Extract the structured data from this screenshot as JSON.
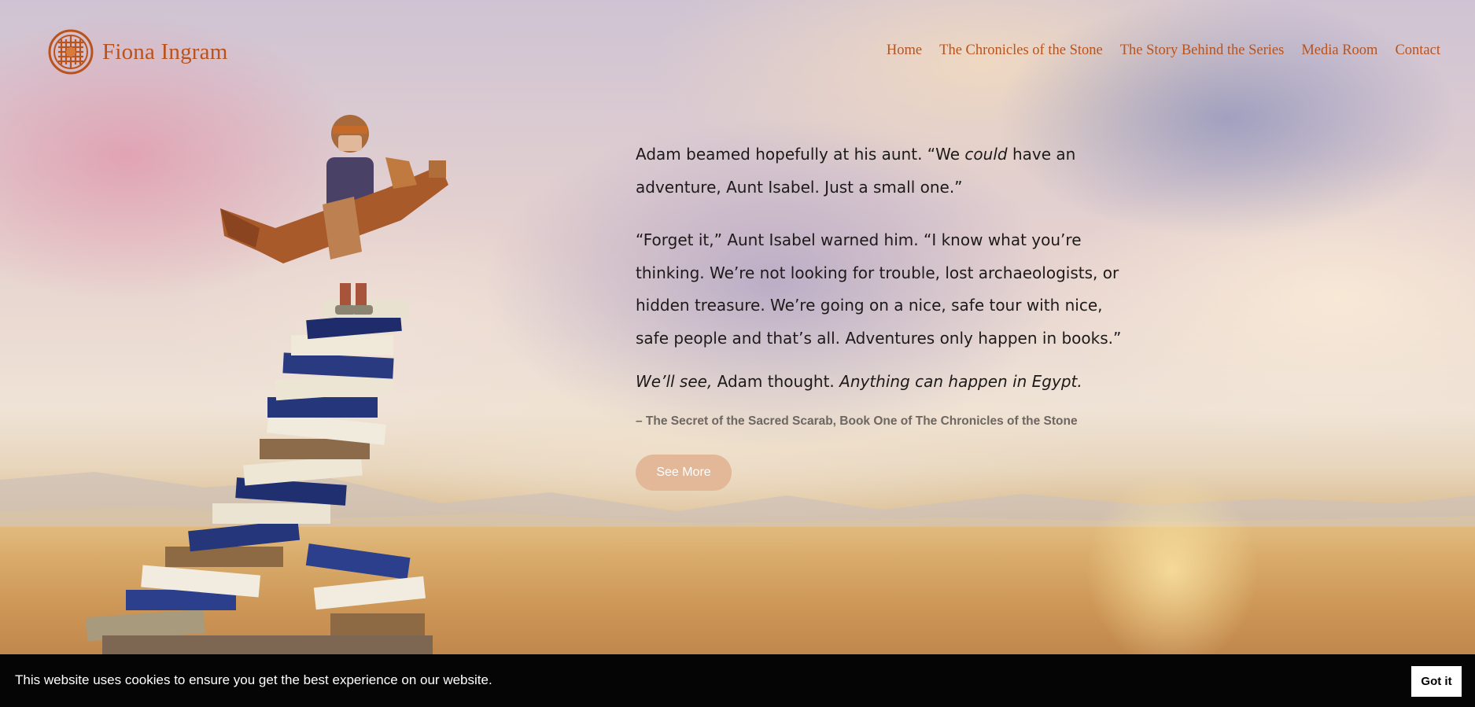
{
  "site": {
    "logo_text": "Fiona Ingram",
    "logo_icon": "celtic-knot-icon",
    "brand_color": "#b9531c"
  },
  "nav": {
    "items": [
      {
        "label": "Home"
      },
      {
        "label": "The Chronicles of the Stone"
      },
      {
        "label": "The Story Behind the Series"
      },
      {
        "label": "Media Room"
      },
      {
        "label": "Contact"
      }
    ]
  },
  "quote": {
    "p1_a": "Adam beamed hopefully at his aunt. “We ",
    "p1_em": "could",
    "p1_b": " have an adventure, Aunt Isabel. Just a small one.”",
    "p2": "“Forget it,” Aunt Isabel warned him. “I know what you’re thinking. We’re not looking for trouble, lost archaeologists, or hidden treasure. We’re going on a nice, safe tour with nice, safe people and that’s all. Adventures only happen in books.”",
    "p3_em1": "We’ll see,",
    "p3_mid": " Adam thought. ",
    "p3_em2": "Anything can happen in Egypt.",
    "attribution": "– The Secret of the Sacred Scarab, Book One of The Chronicles of the Stone",
    "button_label": "See More",
    "button_color": "#e2b898"
  },
  "cookie": {
    "message": "This website uses cookies to ensure you get the best experience on our website.",
    "button_label": "Got it"
  }
}
